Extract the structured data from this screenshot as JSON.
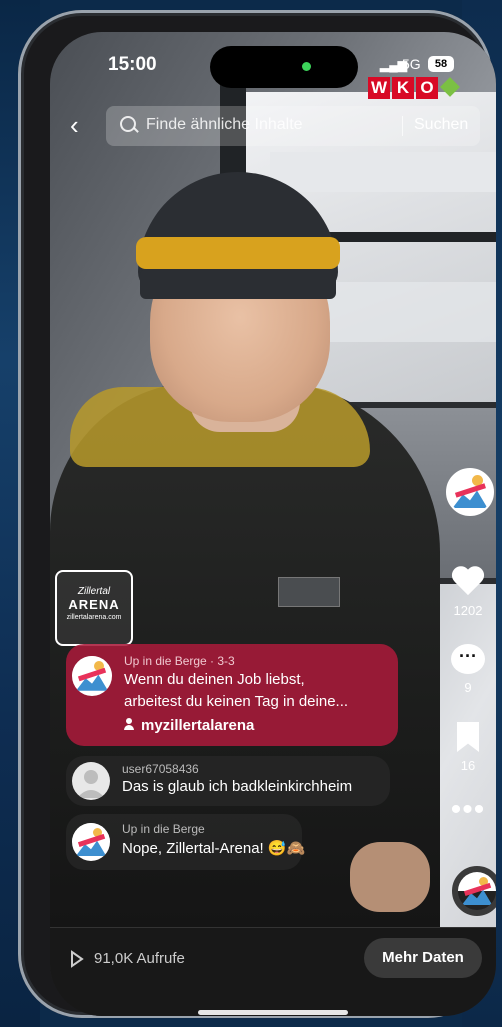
{
  "status_bar": {
    "time": "15:00",
    "network": "5G",
    "battery": "58"
  },
  "overlay_logo": {
    "letters": [
      "W",
      "K",
      "O"
    ]
  },
  "search": {
    "placeholder": "Finde ähnliche Inhalte",
    "button": "Suchen"
  },
  "right_rail": {
    "likes": "1202",
    "comments": "9",
    "saves": "16"
  },
  "video_watermark": {
    "line1": "Zillertal",
    "line2": "ARENA",
    "line3": "zillertalarena.com"
  },
  "pinned": {
    "name": "Up in die Berge · 3-3",
    "text_line1": "Wenn du deinen Job liebst,",
    "text_line2": "arbeitest du keinen Tag in deine...",
    "username": "myzillertalarena"
  },
  "comments": [
    {
      "name": "user67058436",
      "text": "Das is glaub ich badkleinkirchheim"
    },
    {
      "name": "Up in die Berge",
      "text": "Nope, Zillertal-Arena! 😅🙈"
    }
  ],
  "bottom": {
    "views": "91,0K Aufrufe",
    "more_button": "Mehr Daten"
  },
  "colors": {
    "pinned_bg": "#a81a3a",
    "wko_red": "#d80a26",
    "accent_green": "#7bc043"
  }
}
